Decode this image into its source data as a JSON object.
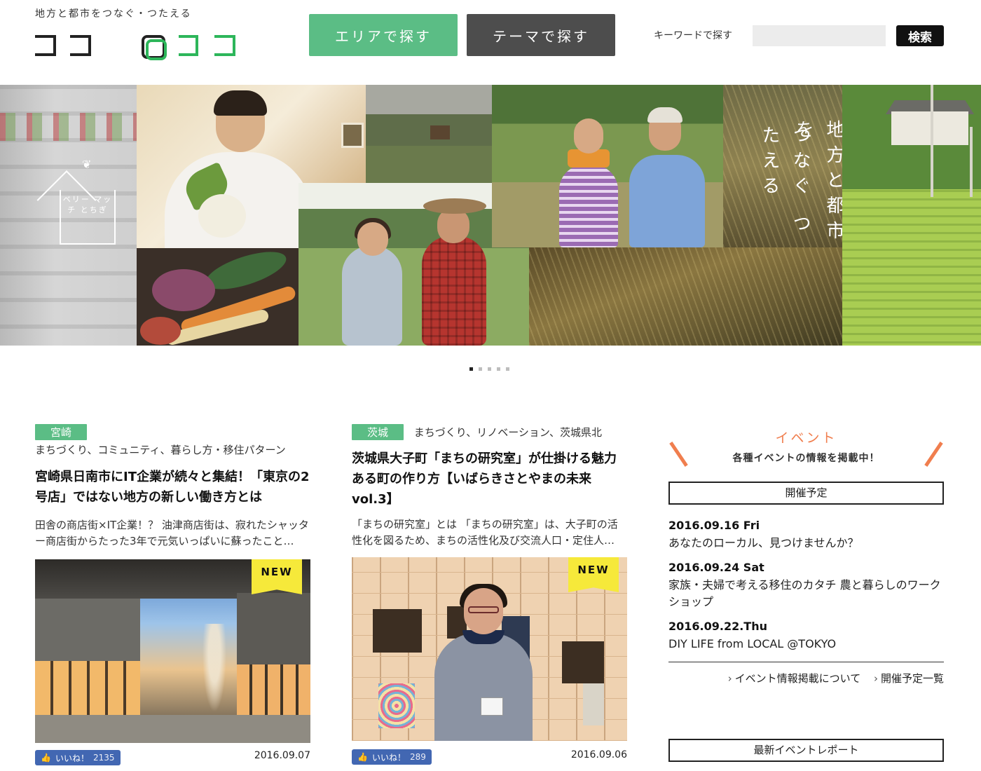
{
  "header": {
    "tagline": "地方と都市をつなぐ・つたえる",
    "logo_text": "ココロココ",
    "nav_area": "エリアで探す",
    "nav_theme": "テーマで探す",
    "keyword_label": "キーワードで探す",
    "keyword_value": "",
    "search_button": "検索"
  },
  "hero": {
    "berry_logo": "ベリー マッチ とちぎ",
    "caption_col1": "地方と都市を",
    "caption_col2": "つなぐ つたえる",
    "slides": 5,
    "active_slide": 1
  },
  "articles": [
    {
      "pref": "宮崎",
      "tags": "まちづくり、コミュニティ、暮らし方・移住パターン",
      "title": "宮崎県日南市にIT企業が続々と集結！「東京の2号店」ではない地方の新しい働き方とは",
      "excerpt": "田舎の商店街×IT企業！？ 油津商店街は、寂れたシャッター商店街からたった3年で元気いっぱいに蘇ったこと…",
      "new_label": "NEW",
      "like_label": "いいね！",
      "like_count": "2135",
      "date": "2016.09.07"
    },
    {
      "pref": "茨城",
      "tags": "まちづくり、リノベーション、茨城県北",
      "title": "茨城県大子町「まちの研究室」が仕掛ける魅力ある町の作り方【いばらきさとやまの未来vol.3】",
      "excerpt": "「まちの研究室」とは 「まちの研究室」は、大子町の活性化を図るため、まちの活性化及び交流人口・定住人…",
      "new_label": "NEW",
      "like_label": "いいね！",
      "like_count": "289",
      "date": "2016.09.06"
    }
  ],
  "events": {
    "title": "イベント",
    "subtitle": "各種イベントの情報を掲載中！",
    "upcoming_label": "開催予定",
    "items": [
      {
        "date": "2016.09.16 Fri",
        "name": "あなたのローカル、見つけませんか？"
      },
      {
        "date": "2016.09.24 Sat",
        "name": "家族・夫婦で考える移住のカタチ 農と暮らしのワークショップ"
      },
      {
        "date": "2016.09.22.Thu",
        "name": "DIY LIFE from LOCAL @TOKYO"
      }
    ],
    "link_about": "イベント情報掲載について",
    "link_list": "開催予定一覧",
    "report_label": "最新イベントレポート"
  },
  "colors": {
    "brand_green": "#5bbd85",
    "nav_dark": "#4d4d4d",
    "event_orange": "#f07e4e",
    "new_yellow": "#f6e93a",
    "facebook_blue": "#4267b2"
  }
}
